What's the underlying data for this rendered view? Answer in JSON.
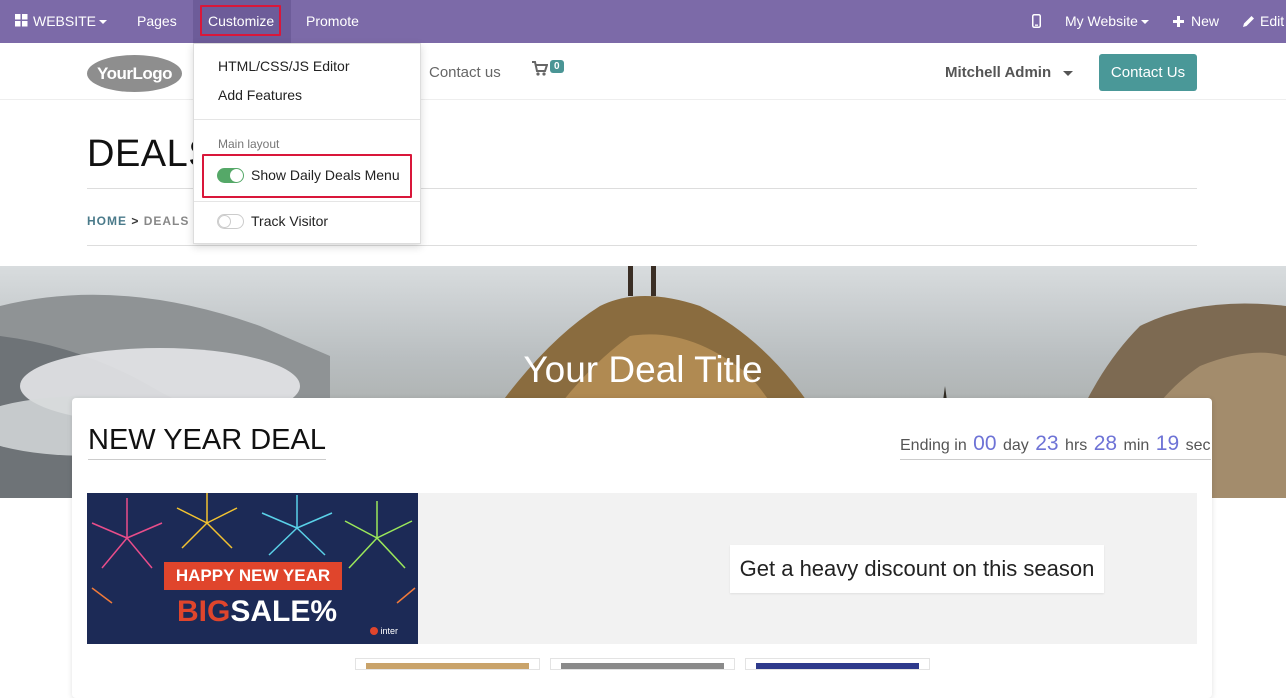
{
  "topbar": {
    "website_label": "WEBSITE",
    "pages_label": "Pages",
    "customize_label": "Customize",
    "promote_label": "Promote",
    "my_website_label": "My Website",
    "new_label": "New",
    "edit_label": "Edit"
  },
  "customize_menu": {
    "editor_label": "HTML/CSS/JS Editor",
    "add_features_label": "Add Features",
    "section_header": "Main layout",
    "show_daily_deals_label": "Show Daily Deals Menu",
    "show_daily_deals_enabled": true,
    "track_visitor_label": "Track Visitor",
    "track_visitor_enabled": false
  },
  "navbar": {
    "logo_text": "YourLogo",
    "contact_link": "Contact us",
    "cart_count": "0",
    "user_name": "Mitchell Admin",
    "contact_button": "Contact Us"
  },
  "page": {
    "title": "DEALS",
    "breadcrumb_home": "HOME",
    "breadcrumb_sep": ">",
    "breadcrumb_current": "DEALS"
  },
  "banner": {
    "title": "Your Deal Title"
  },
  "deal": {
    "name": "NEW YEAR DEAL",
    "ending_prefix": "Ending in",
    "days": "00",
    "days_unit": "day",
    "hours": "23",
    "hours_unit": "hrs",
    "minutes": "28",
    "minutes_unit": "min",
    "seconds": "19",
    "seconds_unit": "sec",
    "image_line1": "HAPPY NEW YEAR",
    "image_line2_a": "BIG",
    "image_line2_b": "SALE%",
    "image_brand": "inter",
    "promo_text": "Get a heavy discount on this season"
  },
  "colors": {
    "topbar": "#7c6aa8",
    "accent": "#4a9898",
    "highlight": "#d9173a",
    "toggle_on": "#55a868",
    "countdown": "#6e73d6"
  }
}
